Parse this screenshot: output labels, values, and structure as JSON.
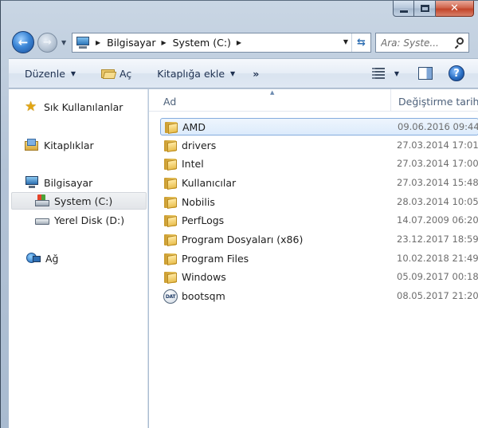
{
  "window": {
    "caption_buttons": {
      "minimize": "minimize",
      "maximize": "maximize",
      "close": "✕"
    }
  },
  "address_bar": {
    "breadcrumbs": [
      "Bilgisayar",
      "System (C:)"
    ],
    "icon": "computer-icon"
  },
  "search": {
    "placeholder": "Ara: Syste..."
  },
  "toolbar": {
    "organize_label": "Düzenle",
    "open_label": "Aç",
    "include_in_library_label": "Kitaplığa ekle",
    "more_label": "»"
  },
  "nav_pane": {
    "items": [
      {
        "label": "Sık Kullanılanlar",
        "icon": "star-icon"
      },
      {
        "label": "Kitaplıklar",
        "icon": "libraries-icon"
      },
      {
        "label": "Bilgisayar",
        "icon": "computer-icon"
      },
      {
        "label": "System (C:)",
        "icon": "system-drive-icon",
        "selected": true
      },
      {
        "label": "Yerel Disk (D:)",
        "icon": "disk-drive-icon"
      },
      {
        "label": "Ağ",
        "icon": "network-icon"
      }
    ]
  },
  "file_list": {
    "columns": {
      "name": "Ad",
      "date_modified": "Değiştirme tarihi"
    },
    "rows": [
      {
        "name": "AMD",
        "date": "09.06.2016 09:44",
        "type": "folder",
        "selected": true
      },
      {
        "name": "drivers",
        "date": "27.03.2014 17:01",
        "type": "folder"
      },
      {
        "name": "Intel",
        "date": "27.03.2014 17:00",
        "type": "folder"
      },
      {
        "name": "Kullanıcılar",
        "date": "27.03.2014 15:48",
        "type": "folder"
      },
      {
        "name": "Nobilis",
        "date": "28.03.2014 10:05",
        "type": "folder"
      },
      {
        "name": "PerfLogs",
        "date": "14.07.2009 06:20",
        "type": "folder"
      },
      {
        "name": "Program Dosyaları (x86)",
        "date": "23.12.2017 18:59",
        "type": "folder"
      },
      {
        "name": "Program Files",
        "date": "10.02.2018 21:49",
        "type": "folder"
      },
      {
        "name": "Windows",
        "date": "05.09.2017 00:18",
        "type": "folder"
      },
      {
        "name": "bootsqm",
        "date": "08.05.2017 21:20",
        "type": "dat-file",
        "icon_text": "DAT"
      }
    ]
  }
}
